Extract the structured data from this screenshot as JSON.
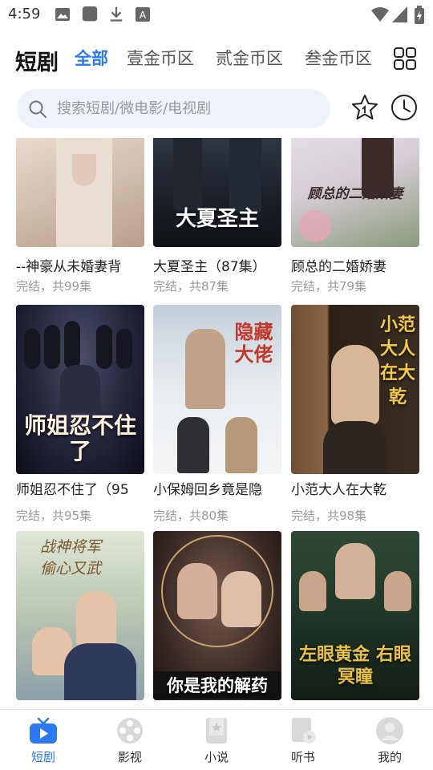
{
  "status_bar": {
    "time": "4:59"
  },
  "header": {
    "app_title": "短剧",
    "tabs": [
      {
        "label": "全部",
        "active": true
      },
      {
        "label": "壹金币区",
        "active": false
      },
      {
        "label": "贰金币区",
        "active": false
      },
      {
        "label": "叁金币区",
        "active": false
      }
    ]
  },
  "search": {
    "placeholder": "搜索短剧/微电影/电视剧"
  },
  "cards": [
    {
      "title": "--神豪从未婚妻背",
      "subtitle": "完结，共99集",
      "poster_text": ""
    },
    {
      "title": "大夏圣主（87集）",
      "subtitle": "完结，共87集",
      "poster_text": "大夏圣主"
    },
    {
      "title": "顾总的二婚娇妻",
      "subtitle": "完结，共79集",
      "poster_text": "顾总的二婚娇妻"
    },
    {
      "title": "师姐忍不住了（95",
      "subtitle": "完结，共95集",
      "poster_text": "师姐忍不住了"
    },
    {
      "title": "小保姆回乡竟是隐",
      "subtitle": "完结，共80集",
      "poster_text": "隐藏大佬"
    },
    {
      "title": "小范大人在大乾",
      "subtitle": "完结，共98集",
      "poster_text": "小范大人在大乾"
    },
    {
      "title": "",
      "subtitle": "",
      "poster_text": "你是我的解药"
    },
    {
      "title": "",
      "subtitle": "",
      "poster_text": "你是我的解药"
    },
    {
      "title": "",
      "subtitle": "",
      "poster_text": "左眼黄金 右眼冥瞳"
    }
  ],
  "bottom_nav": [
    {
      "label": "短剧",
      "active": true
    },
    {
      "label": "影视",
      "active": false
    },
    {
      "label": "小说",
      "active": false
    },
    {
      "label": "听书",
      "active": false
    },
    {
      "label": "我的",
      "active": false
    }
  ],
  "colors": {
    "accent": "#2c79f0",
    "search_bg": "#eef3fb",
    "subtext": "#9a9a9a"
  }
}
